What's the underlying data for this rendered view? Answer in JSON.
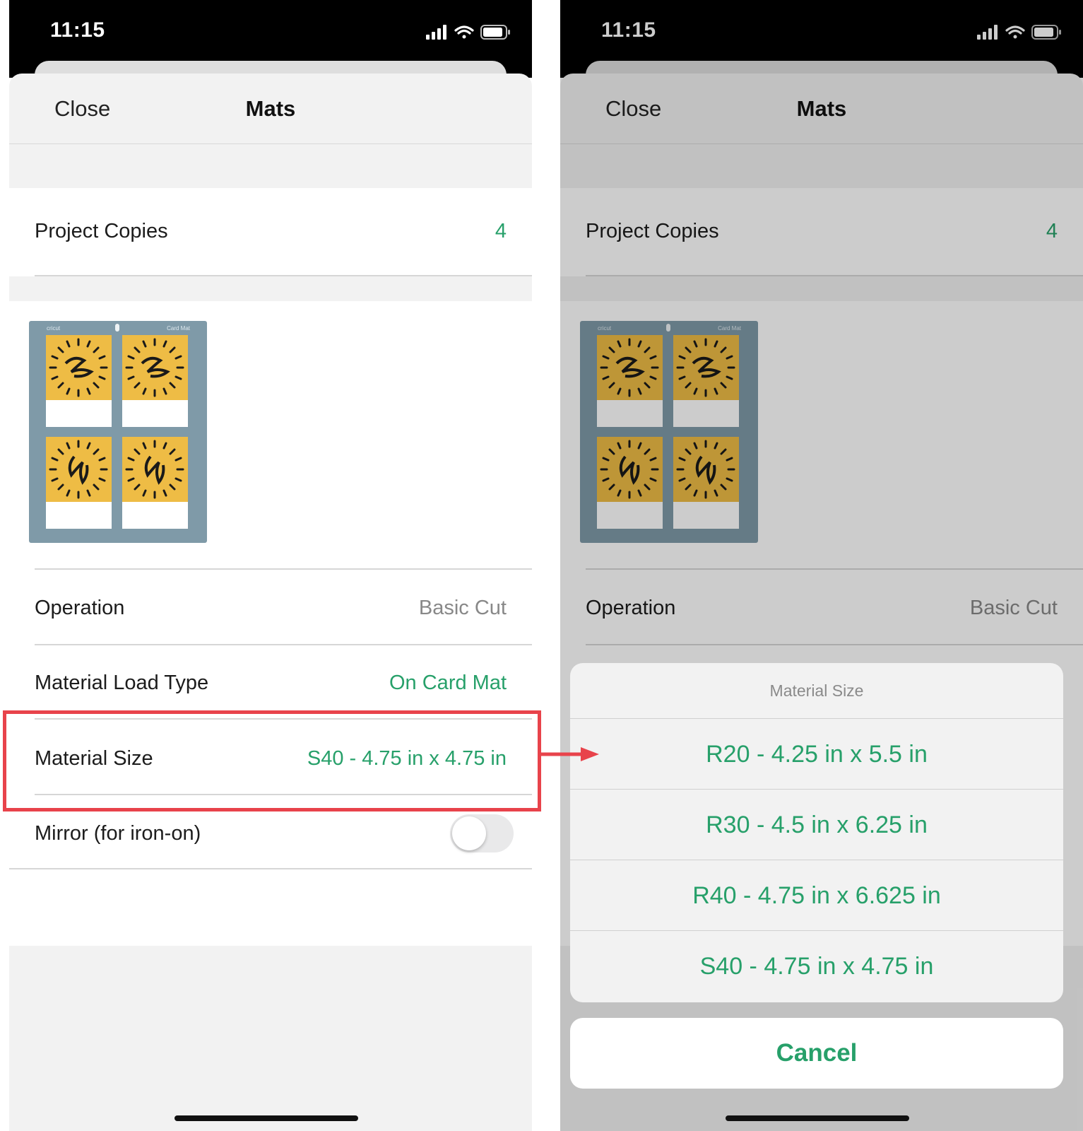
{
  "left": {
    "status": {
      "time": "11:15"
    },
    "nav": {
      "close_label": "Close",
      "title": "Mats"
    },
    "project_copies": {
      "label": "Project Copies",
      "value": "4"
    },
    "mat": {
      "brand": "cricut",
      "label": "Card Mat"
    },
    "operation": {
      "label": "Operation",
      "value": "Basic Cut"
    },
    "material_load_type": {
      "label": "Material Load Type",
      "value": "On Card Mat"
    },
    "material_size": {
      "label": "Material Size",
      "value": "S40 - 4.75 in x 4.75 in"
    },
    "mirror": {
      "label": "Mirror (for iron-on)",
      "on": false
    }
  },
  "right": {
    "status": {
      "time": "11:15"
    },
    "nav": {
      "close_label": "Close",
      "title": "Mats"
    },
    "project_copies": {
      "label": "Project Copies",
      "value": "4"
    },
    "mat": {
      "brand": "cricut",
      "label": "Card Mat"
    },
    "operation": {
      "label": "Operation",
      "value": "Basic Cut"
    },
    "action_sheet": {
      "title": "Material Size",
      "options": [
        "R20 - 4.25 in x 5.5 in",
        "R30 - 4.5 in x 6.25 in",
        "R40 - 4.75 in x 6.625 in",
        "S40 - 4.75 in x 4.75 in"
      ],
      "cancel_label": "Cancel"
    }
  },
  "colors": {
    "accent": "#27a06a",
    "highlight": "#e8434b",
    "mat": "#7f9aa8",
    "card_art": "#eebc45"
  },
  "icons": [
    "cellular-signal-icon",
    "wifi-icon",
    "battery-icon",
    "arrow-right-icon"
  ]
}
